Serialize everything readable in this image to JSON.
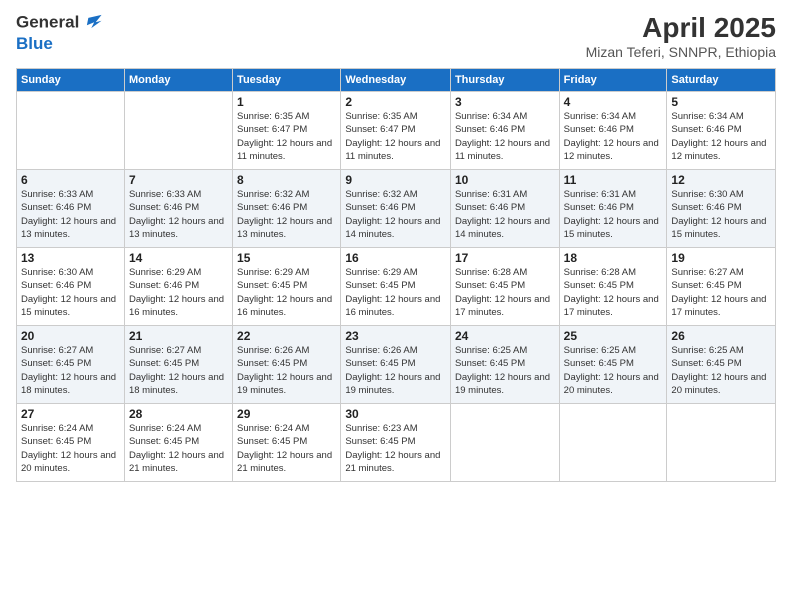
{
  "logo": {
    "line1": "General",
    "line2": "Blue"
  },
  "title": "April 2025",
  "subtitle": "Mizan Teferi, SNNPR, Ethiopia",
  "weekdays": [
    "Sunday",
    "Monday",
    "Tuesday",
    "Wednesday",
    "Thursday",
    "Friday",
    "Saturday"
  ],
  "weeks": [
    [
      {
        "day": "",
        "info": ""
      },
      {
        "day": "",
        "info": ""
      },
      {
        "day": "1",
        "info": "Sunrise: 6:35 AM\nSunset: 6:47 PM\nDaylight: 12 hours and 11 minutes."
      },
      {
        "day": "2",
        "info": "Sunrise: 6:35 AM\nSunset: 6:47 PM\nDaylight: 12 hours and 11 minutes."
      },
      {
        "day": "3",
        "info": "Sunrise: 6:34 AM\nSunset: 6:46 PM\nDaylight: 12 hours and 11 minutes."
      },
      {
        "day": "4",
        "info": "Sunrise: 6:34 AM\nSunset: 6:46 PM\nDaylight: 12 hours and 12 minutes."
      },
      {
        "day": "5",
        "info": "Sunrise: 6:34 AM\nSunset: 6:46 PM\nDaylight: 12 hours and 12 minutes."
      }
    ],
    [
      {
        "day": "6",
        "info": "Sunrise: 6:33 AM\nSunset: 6:46 PM\nDaylight: 12 hours and 13 minutes."
      },
      {
        "day": "7",
        "info": "Sunrise: 6:33 AM\nSunset: 6:46 PM\nDaylight: 12 hours and 13 minutes."
      },
      {
        "day": "8",
        "info": "Sunrise: 6:32 AM\nSunset: 6:46 PM\nDaylight: 12 hours and 13 minutes."
      },
      {
        "day": "9",
        "info": "Sunrise: 6:32 AM\nSunset: 6:46 PM\nDaylight: 12 hours and 14 minutes."
      },
      {
        "day": "10",
        "info": "Sunrise: 6:31 AM\nSunset: 6:46 PM\nDaylight: 12 hours and 14 minutes."
      },
      {
        "day": "11",
        "info": "Sunrise: 6:31 AM\nSunset: 6:46 PM\nDaylight: 12 hours and 15 minutes."
      },
      {
        "day": "12",
        "info": "Sunrise: 6:30 AM\nSunset: 6:46 PM\nDaylight: 12 hours and 15 minutes."
      }
    ],
    [
      {
        "day": "13",
        "info": "Sunrise: 6:30 AM\nSunset: 6:46 PM\nDaylight: 12 hours and 15 minutes."
      },
      {
        "day": "14",
        "info": "Sunrise: 6:29 AM\nSunset: 6:46 PM\nDaylight: 12 hours and 16 minutes."
      },
      {
        "day": "15",
        "info": "Sunrise: 6:29 AM\nSunset: 6:45 PM\nDaylight: 12 hours and 16 minutes."
      },
      {
        "day": "16",
        "info": "Sunrise: 6:29 AM\nSunset: 6:45 PM\nDaylight: 12 hours and 16 minutes."
      },
      {
        "day": "17",
        "info": "Sunrise: 6:28 AM\nSunset: 6:45 PM\nDaylight: 12 hours and 17 minutes."
      },
      {
        "day": "18",
        "info": "Sunrise: 6:28 AM\nSunset: 6:45 PM\nDaylight: 12 hours and 17 minutes."
      },
      {
        "day": "19",
        "info": "Sunrise: 6:27 AM\nSunset: 6:45 PM\nDaylight: 12 hours and 17 minutes."
      }
    ],
    [
      {
        "day": "20",
        "info": "Sunrise: 6:27 AM\nSunset: 6:45 PM\nDaylight: 12 hours and 18 minutes."
      },
      {
        "day": "21",
        "info": "Sunrise: 6:27 AM\nSunset: 6:45 PM\nDaylight: 12 hours and 18 minutes."
      },
      {
        "day": "22",
        "info": "Sunrise: 6:26 AM\nSunset: 6:45 PM\nDaylight: 12 hours and 19 minutes."
      },
      {
        "day": "23",
        "info": "Sunrise: 6:26 AM\nSunset: 6:45 PM\nDaylight: 12 hours and 19 minutes."
      },
      {
        "day": "24",
        "info": "Sunrise: 6:25 AM\nSunset: 6:45 PM\nDaylight: 12 hours and 19 minutes."
      },
      {
        "day": "25",
        "info": "Sunrise: 6:25 AM\nSunset: 6:45 PM\nDaylight: 12 hours and 20 minutes."
      },
      {
        "day": "26",
        "info": "Sunrise: 6:25 AM\nSunset: 6:45 PM\nDaylight: 12 hours and 20 minutes."
      }
    ],
    [
      {
        "day": "27",
        "info": "Sunrise: 6:24 AM\nSunset: 6:45 PM\nDaylight: 12 hours and 20 minutes."
      },
      {
        "day": "28",
        "info": "Sunrise: 6:24 AM\nSunset: 6:45 PM\nDaylight: 12 hours and 21 minutes."
      },
      {
        "day": "29",
        "info": "Sunrise: 6:24 AM\nSunset: 6:45 PM\nDaylight: 12 hours and 21 minutes."
      },
      {
        "day": "30",
        "info": "Sunrise: 6:23 AM\nSunset: 6:45 PM\nDaylight: 12 hours and 21 minutes."
      },
      {
        "day": "",
        "info": ""
      },
      {
        "day": "",
        "info": ""
      },
      {
        "day": "",
        "info": ""
      }
    ]
  ]
}
